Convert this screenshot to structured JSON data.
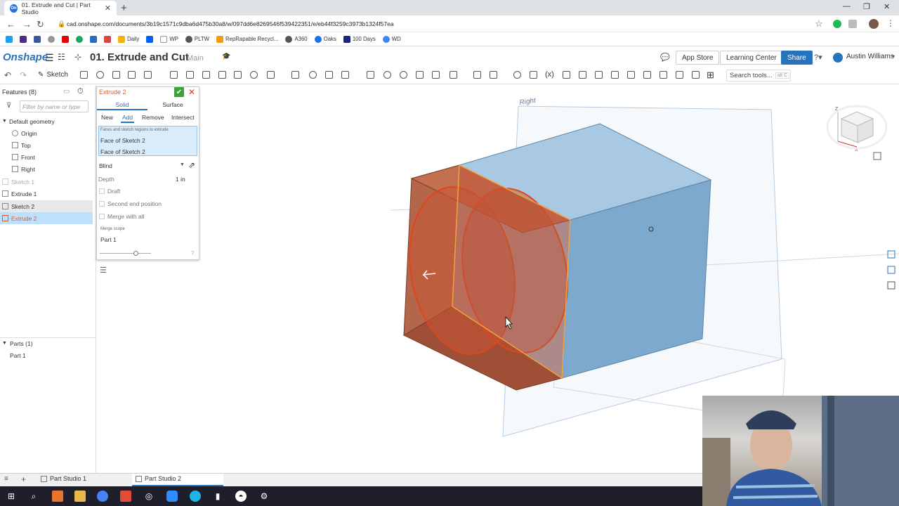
{
  "browser": {
    "tab_title": "01. Extrude and Cut | Part Studio",
    "url": "cad.onshape.com/documents/3b19c1571c9dba6d475b30a8/w/097dd6e8269546f539422351/e/eb44f3259c3973b1324f57ea",
    "bookmarks": [
      "Daily",
      "WP",
      "PLTW",
      "RepRapable Recycl...",
      "A360",
      "Oaks",
      "100 Days",
      "WD"
    ]
  },
  "app": {
    "logo": "Onshape",
    "doc_title": "01. Extrude and Cut",
    "branch": "Main",
    "app_store": "App Store",
    "learning_center": "Learning Center",
    "share": "Share",
    "user": "Austin Williams",
    "sketch_label": "Sketch",
    "search_tools": "Search tools...",
    "search_shortcut": "alt C"
  },
  "features": {
    "title": "Features (8)",
    "filter_placeholder": "Filter by name or type",
    "default_geometry": "Default geometry",
    "items": [
      "Origin",
      "Top",
      "Front",
      "Right",
      "Sketch 1",
      "Extrude 1",
      "Sketch 2",
      "Extrude 2"
    ],
    "parts_title": "Parts (1)",
    "parts": [
      "Part 1"
    ]
  },
  "dialog": {
    "title": "Extrude 2",
    "type_solid": "Solid",
    "type_surface": "Surface",
    "op_new": "New",
    "op_add": "Add",
    "op_remove": "Remove",
    "op_intersect": "Intersect",
    "faces_label": "Faces and sketch regions to extrude",
    "faces": [
      "Face of Sketch 2",
      "Face of Sketch 2"
    ],
    "end_type": "Blind",
    "depth_label": "Depth",
    "depth_value": "1 in",
    "draft": "Draft",
    "second_end": "Second end position",
    "merge_all": "Merge with all",
    "merge_scope_label": "Merge scope",
    "merge_scope_value": "Part 1",
    "slider_value": 0.7
  },
  "viewport": {
    "plane_label": "Right"
  },
  "bottom_tabs": [
    "Part Studio 1",
    "Part Studio 2"
  ],
  "colors": {
    "accent": "#2873bd",
    "body_blue": "#8fb8d8",
    "extrude_orange": "#c8583a"
  }
}
